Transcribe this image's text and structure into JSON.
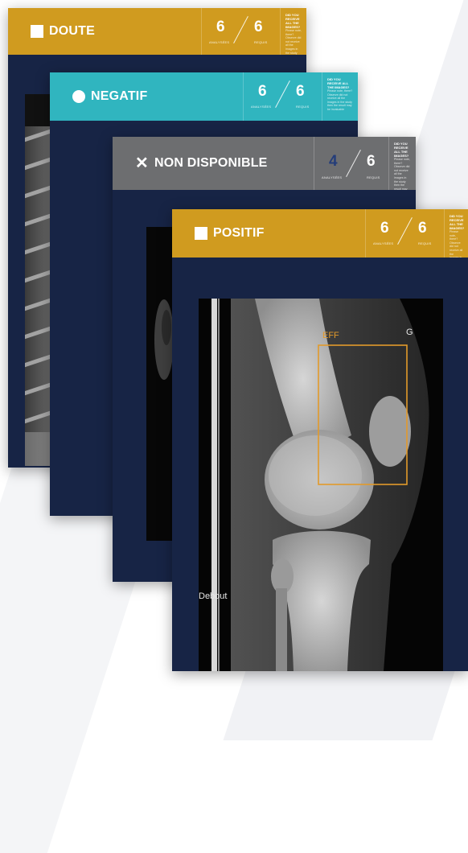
{
  "cards": [
    {
      "status": "DOUTE",
      "icon": "square-icon",
      "color": "#d09b1f",
      "analyses": "6",
      "requis": "6",
      "analyses_label": "ANALYSÉES",
      "requis_label": "REQUIS",
      "note_title": "DID YOU RECEIVE ALL THE IMAGES?",
      "note_text": "Please note, there? Observe did not receive all the images in the study then the result may be invaluable"
    },
    {
      "status": "NEGATIF",
      "icon": "circle-icon",
      "color": "#30b5bf",
      "analyses": "6",
      "requis": "6",
      "analyses_label": "ANALYSÉES",
      "requis_label": "REQUIS",
      "note_title": "DID YOU RECEIVE ALL THE IMAGES?",
      "note_text": "Please note, there? Observe did not receive all the images in the study then the result may be invaluable"
    },
    {
      "status": "NON DISPONIBLE",
      "icon": "x-icon",
      "color": "#6d6e70",
      "analyses": "4",
      "requis": "6",
      "analyses_label": "ANALYSÉES",
      "requis_label": "REQUIS",
      "note_title": "DID YOU RECEIVE ALL THE IMAGES?",
      "note_text": "Please note, there? Observe did not receive all the images in the study then the result may be invaluable"
    },
    {
      "status": "POSITIF",
      "icon": "square-icon",
      "color": "#d09b1f",
      "analyses": "6",
      "requis": "6",
      "analyses_label": "ANALYSÉES",
      "requis_label": "REQUIS",
      "note_title": "DID YOU RECEIVE ALL THE IMAGES?",
      "note_text": "Please note, there? Observe did not receive all the images in the study then the result may be invaluable"
    }
  ],
  "xray_annotations": {
    "finding_label": "EFF",
    "finding_color": "#e29a2b",
    "side_marker": "G",
    "position_marker": "Debout"
  }
}
